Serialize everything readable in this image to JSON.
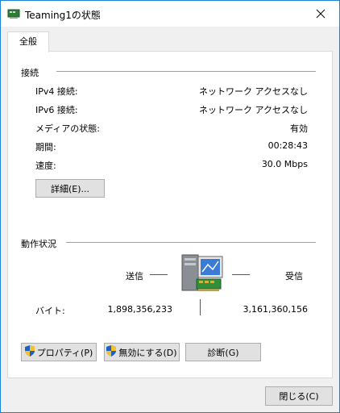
{
  "window": {
    "title": "Teaming1の状態"
  },
  "tabs": [
    {
      "label": "全般"
    }
  ],
  "connection": {
    "heading": "接続",
    "rows": [
      {
        "label": "IPv4 接続:",
        "value": "ネットワーク アクセスなし"
      },
      {
        "label": "IPv6 接続:",
        "value": "ネットワーク アクセスなし"
      },
      {
        "label": "メディアの状態:",
        "value": "有効"
      },
      {
        "label": "期間:",
        "value": "00:28:43"
      },
      {
        "label": "速度:",
        "value": "30.0 Mbps"
      }
    ],
    "details_button": "詳細(E)..."
  },
  "activity": {
    "heading": "動作状況",
    "sent_label": "送信",
    "received_label": "受信",
    "bytes_label": "バイト:",
    "sent_bytes": "1,898,356,233",
    "received_bytes": "3,161,360,156"
  },
  "actions": {
    "properties": "プロパティ(P)",
    "disable": "無効にする(D)",
    "diagnose": "診断(G)"
  },
  "footer": {
    "close": "閉じる(C)"
  },
  "colors": {
    "accent": "#1883d7",
    "shield_blue": "#1f5fbf",
    "shield_yellow": "#f2c12e"
  }
}
